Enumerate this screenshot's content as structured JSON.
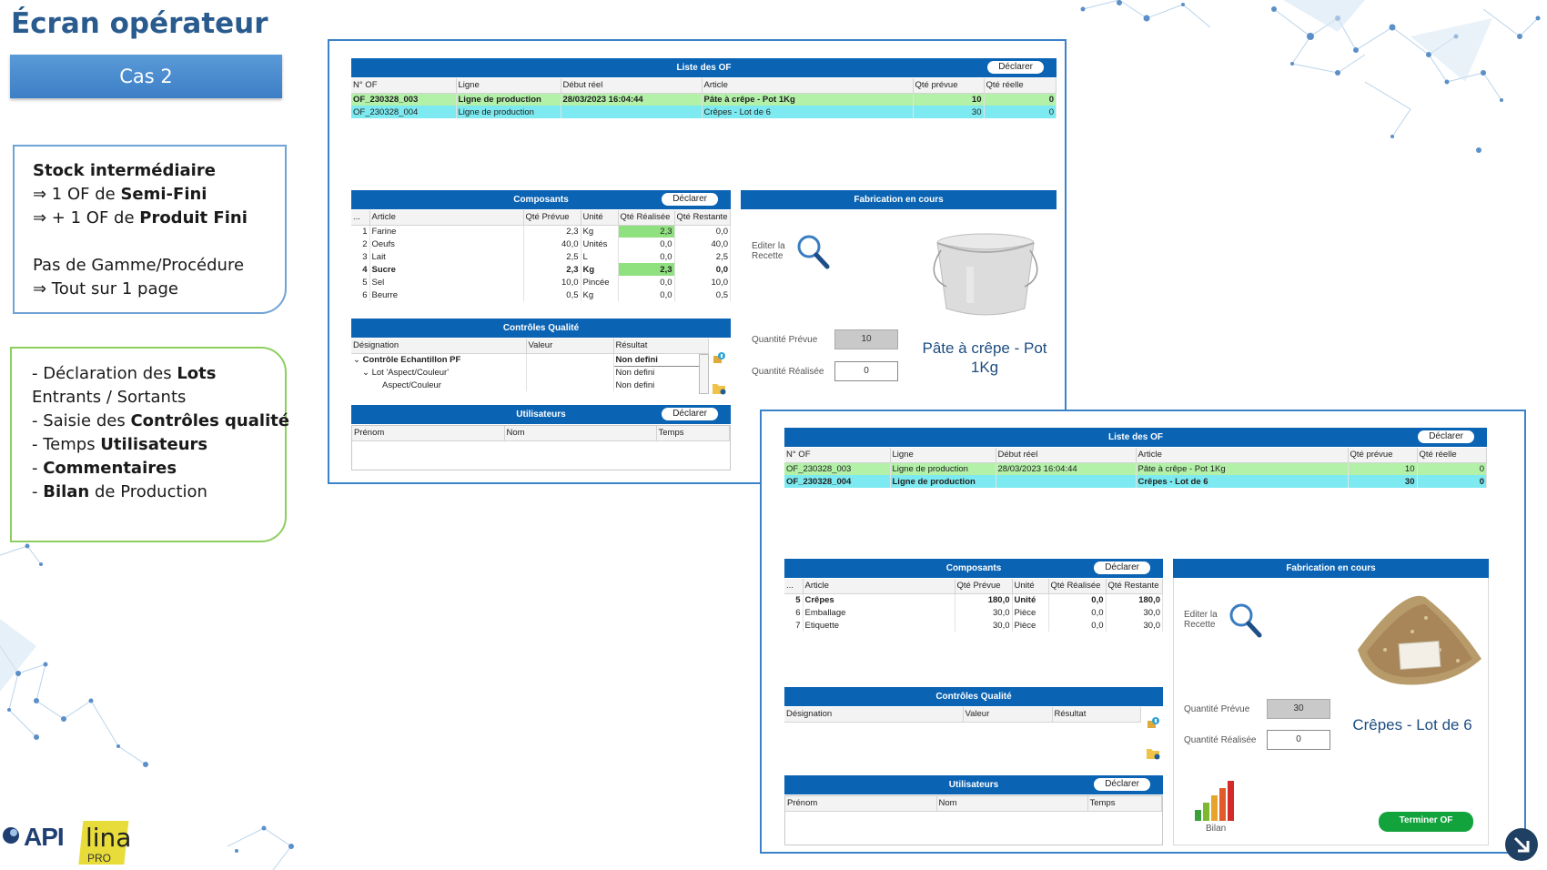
{
  "slide": {
    "title": "Écran opérateur",
    "case_label": "Cas 2"
  },
  "note_blue": {
    "lines": [
      {
        "pre": "",
        "bold": "Stock intermédiaire",
        "post": ""
      },
      {
        "pre": "⇒ 1 OF de ",
        "bold": "Semi-Fini",
        "post": ""
      },
      {
        "pre": "⇒ + 1 OF de ",
        "bold": "Produit Fini",
        "post": ""
      },
      {
        "pre": "",
        "bold": "",
        "post": ""
      },
      {
        "pre": "Pas de Gamme/Procédure",
        "bold": "",
        "post": ""
      },
      {
        "pre": "⇒ Tout sur 1 page",
        "bold": "",
        "post": ""
      }
    ]
  },
  "note_green": {
    "lines": [
      {
        "pre": "- Déclaration des ",
        "bold": "Lots",
        "post": ""
      },
      {
        "pre": "Entrants / Sortants",
        "bold": "",
        "post": ""
      },
      {
        "pre": "- Saisie des ",
        "bold": "Contrôles qualité",
        "post": ""
      },
      {
        "pre": "- Temps ",
        "bold": "Utilisateurs",
        "post": ""
      },
      {
        "pre": "- ",
        "bold": "Commentaires",
        "post": ""
      },
      {
        "pre": "- ",
        "bold": "Bilan",
        "post": " de Production"
      }
    ]
  },
  "common": {
    "declarer": "Déclarer",
    "liste_of_title": "Liste des OF",
    "composants_title": "Composants",
    "fabrication_title": "Fabrication en cours",
    "controles_title": "Contrôles Qualité",
    "utilisateurs_title": "Utilisateurs",
    "of_headers": [
      "N° OF",
      "Ligne",
      "Début réel",
      "Article",
      "Qté prévue",
      "Qté réelle"
    ],
    "comp_headers": [
      "...",
      "Article",
      "Qté Prévue",
      "Unité",
      "Qté Réalisée",
      "Qté Restante"
    ],
    "cq_headers": [
      "Désignation",
      "Valeur",
      "Résultat"
    ],
    "user_headers": [
      "Prénom",
      "Nom",
      "Temps"
    ],
    "editer_recette": "Editer la Recette",
    "quantite_prevue_label": "Quantité Prévue",
    "quantite_realisee_label": "Quantité Réalisée"
  },
  "screen1": {
    "of_rows": [
      {
        "of": "OF_230328_003",
        "ligne": "Ligne de production",
        "debut": "28/03/2023 16:04:44",
        "article": "Pâte à crêpe - Pot 1Kg",
        "prevue": "10",
        "reelle": "0",
        "style": "green bold"
      },
      {
        "of": "OF_230328_004",
        "ligne": "Ligne de production",
        "debut": "",
        "article": "Crêpes - Lot de 6",
        "prevue": "30",
        "reelle": "0",
        "style": "cyan"
      }
    ],
    "comp_rows": [
      {
        "n": "1",
        "article": "Farine",
        "prevue": "2,3",
        "unite": "Kg",
        "realisee": "2,3",
        "restante": "0,0",
        "style": "",
        "green": true
      },
      {
        "n": "2",
        "article": "Oeufs",
        "prevue": "40,0",
        "unite": "Unités",
        "realisee": "0,0",
        "restante": "40,0",
        "style": "",
        "green": false
      },
      {
        "n": "3",
        "article": "Lait",
        "prevue": "2,5",
        "unite": "L",
        "realisee": "0,0",
        "restante": "2,5",
        "style": "",
        "green": false
      },
      {
        "n": "4",
        "article": "Sucre",
        "prevue": "2,3",
        "unite": "Kg",
        "realisee": "2,3",
        "restante": "0,0",
        "style": "bold",
        "green": true
      },
      {
        "n": "5",
        "article": "Sel",
        "prevue": "10,0",
        "unite": "Pincée",
        "realisee": "0,0",
        "restante": "10,0",
        "style": "",
        "green": false
      },
      {
        "n": "6",
        "article": "Beurre",
        "prevue": "0,5",
        "unite": "Kg",
        "realisee": "0,0",
        "restante": "0,5",
        "style": "",
        "green": false
      }
    ],
    "cq_rows": [
      {
        "designation": "Contrôle Echantillon PF",
        "prefix": "⌄",
        "indent": 0,
        "valeur": "",
        "resultat": "Non defini",
        "bold": true
      },
      {
        "designation": "Lot 'Aspect/Couleur'",
        "prefix": "⌄",
        "indent": 1,
        "valeur": "",
        "resultat": "Non defini",
        "bold": false
      },
      {
        "designation": "Aspect/Couleur",
        "prefix": "",
        "indent": 2,
        "valeur": "",
        "resultat": "Non defini",
        "bold": false
      }
    ],
    "quantite_prevue": "10",
    "quantite_realisee": "0",
    "article_name": "Pâte à crêpe - Pot 1Kg"
  },
  "screen2": {
    "of_rows": [
      {
        "of": "OF_230328_003",
        "ligne": "Ligne de production",
        "debut": "28/03/2023 16:04:44",
        "article": "Pâte à crêpe - Pot 1Kg",
        "prevue": "10",
        "reelle": "0",
        "style": "green"
      },
      {
        "of": "OF_230328_004",
        "ligne": "Ligne de production",
        "debut": "",
        "article": "Crêpes - Lot de 6",
        "prevue": "30",
        "reelle": "0",
        "style": "cyan bold"
      }
    ],
    "comp_rows": [
      {
        "n": "5",
        "article": "Crêpes",
        "prevue": "180,0",
        "unite": "Unité",
        "realisee": "0,0",
        "restante": "180,0",
        "style": "bold",
        "green": false
      },
      {
        "n": "6",
        "article": "Emballage",
        "prevue": "30,0",
        "unite": "Pièce",
        "realisee": "0,0",
        "restante": "30,0",
        "style": "",
        "green": false
      },
      {
        "n": "7",
        "article": "Etiquette",
        "prevue": "30,0",
        "unite": "Pièce",
        "realisee": "0,0",
        "restante": "30,0",
        "style": "",
        "green": false
      }
    ],
    "quantite_prevue": "30",
    "quantite_realisee": "0",
    "article_name": "Crêpes - Lot de 6",
    "bilan_label": "Bilan",
    "terminer_label": "Terminer OF"
  },
  "logo": {
    "api": "API",
    "lina": "lina",
    "pro": "PRO"
  },
  "colors": {
    "header_blue": "#0a63b3",
    "accent_slide": "#2a5b8e",
    "green_row": "#b3f0a8",
    "cyan_row": "#7ceaf0",
    "terminer_green": "#13a33d"
  }
}
